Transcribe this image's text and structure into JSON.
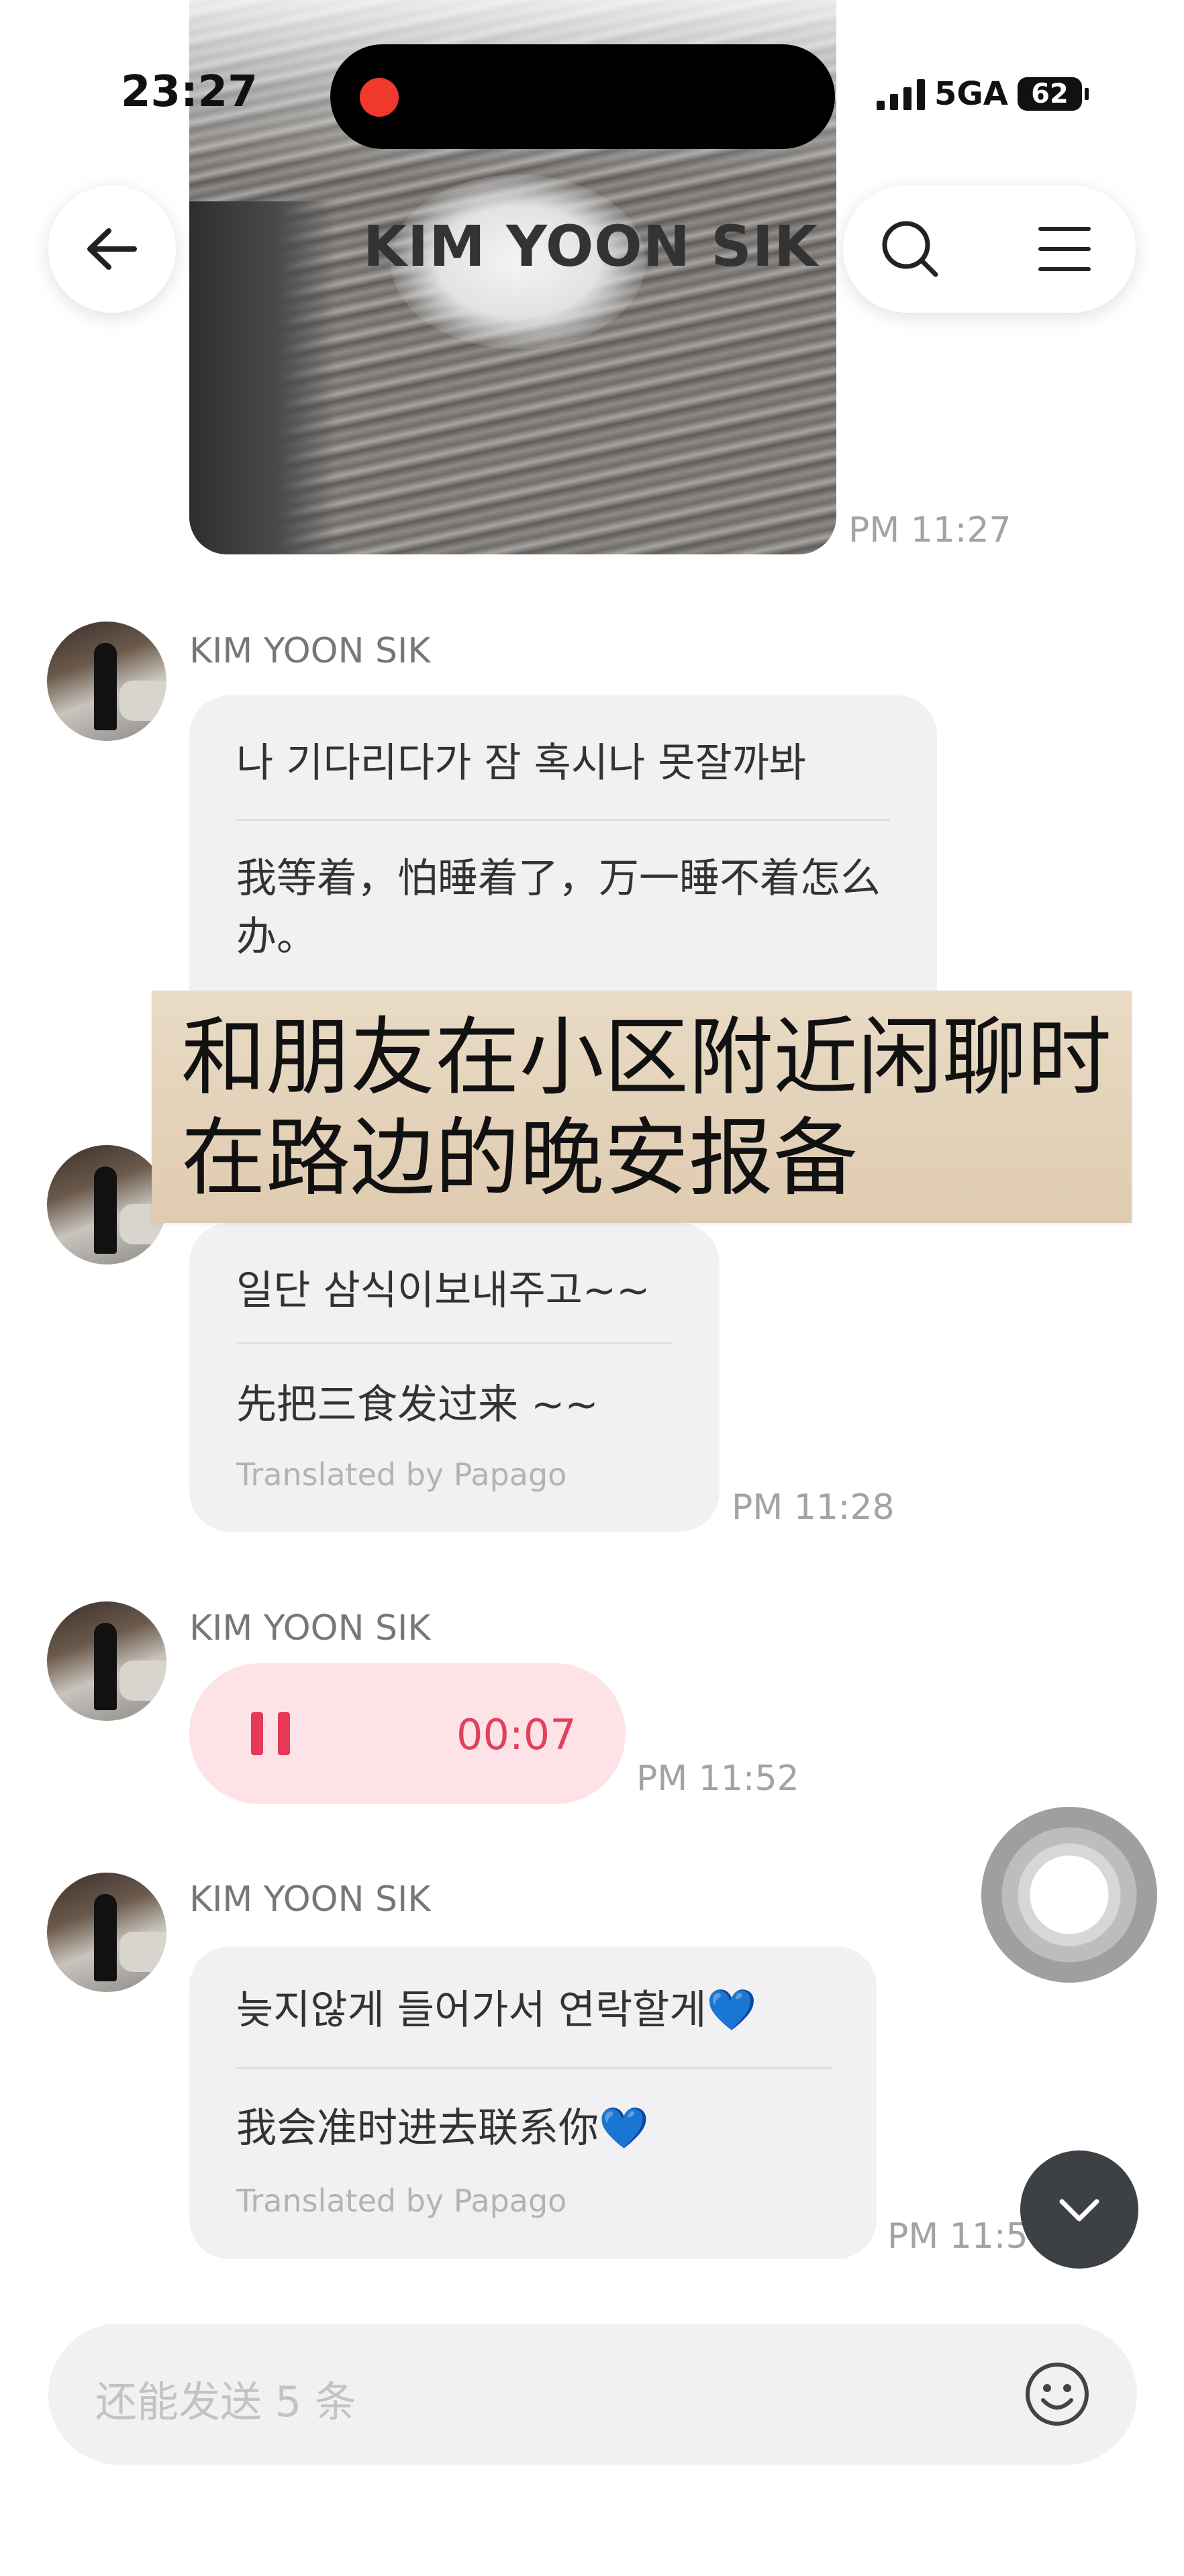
{
  "status_bar": {
    "time": "23:27",
    "network": "5GA",
    "battery": "62"
  },
  "header": {
    "title": "KIM YOON SIK"
  },
  "top_image": {
    "timestamp": "PM 11:27"
  },
  "messages": [
    {
      "sender": "KIM YOON SIK",
      "original": "나 기다리다가 잠 혹시나 못잘까봐",
      "translation": "我等着，怕睡着了，万一睡不着怎么办。"
    },
    {
      "original": "일단 삼식이보내주고~~",
      "translation": "先把三食发过来 ~~",
      "translated_by": "Translated by Papago",
      "timestamp": "PM 11:28"
    },
    {
      "sender": "KIM YOON SIK",
      "voice_duration": "00:07",
      "timestamp": "PM 11:52"
    },
    {
      "sender": "KIM YOON SIK",
      "original": "늦지않게 들어가서 연락할게💙",
      "translation": "我会准时进去联系你💙",
      "translated_by": "Translated by Papago",
      "timestamp": "PM 11:5"
    }
  ],
  "overlay_caption": {
    "line1": "和朋友在小区附近闲聊时",
    "line2": "在路边的晚安报备"
  },
  "input": {
    "placeholder": "还能发送 5 条"
  },
  "icons": [
    "back-arrow-icon",
    "search-icon",
    "menu-icon",
    "pause-icon",
    "chevron-down-icon",
    "smiley-icon"
  ],
  "colors": {
    "voice_bubble": "#fde3e7",
    "voice_accent": "#e73858",
    "overlay_card": "#e5d5bd"
  }
}
